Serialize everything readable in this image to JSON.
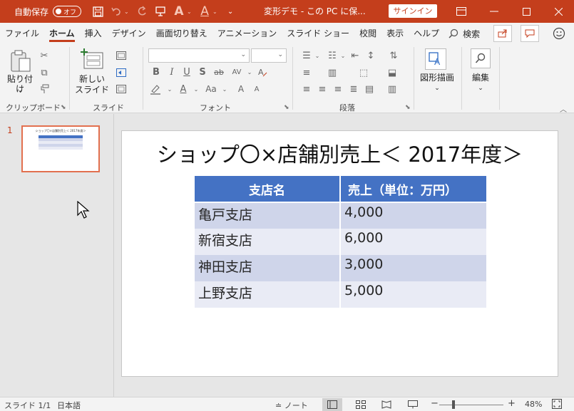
{
  "titlebar": {
    "autosave_label": "自動保存",
    "autosave_state": "オフ",
    "doc_title": "変形デモ - この PC に保...",
    "signin_label": "サインイン"
  },
  "tabs": [
    "ファイル",
    "ホーム",
    "挿入",
    "デザイン",
    "画面切り替え",
    "アニメーション",
    "スライド ショー",
    "校閲",
    "表示",
    "ヘルプ"
  ],
  "active_tab": "ホーム",
  "search_label": "検索",
  "ribbon": {
    "paste_label": "貼り付け",
    "new_slide_label_1": "新しい",
    "new_slide_label_2": "スライド",
    "shape_label": "図形描画",
    "edit_label": "編集",
    "groups": {
      "clipboard": "クリップボード",
      "slides": "スライド",
      "font": "フォント",
      "paragraph": "段落"
    },
    "font_buttons": {
      "bold": "B",
      "italic": "I",
      "underline": "U",
      "shadow": "S",
      "strike": "ab",
      "spacing": "AV",
      "case": "Aa",
      "grow": "A",
      "shrink": "A"
    }
  },
  "thumbnail": {
    "number": "1"
  },
  "slide": {
    "title": "ショップ〇×店舗別売上＜ 2017年度＞",
    "table": {
      "headers": [
        "支店名",
        "売上（単位：万円）"
      ],
      "rows": [
        [
          "亀戸支店",
          "4,000"
        ],
        [
          "新宿支店",
          "6,000"
        ],
        [
          "神田支店",
          "3,000"
        ],
        [
          "上野支店",
          "5,000"
        ]
      ]
    }
  },
  "status": {
    "slide_count": "スライド 1/1",
    "language": "日本語",
    "notes": "ノート",
    "zoom": "48%"
  },
  "colors": {
    "accent": "#c43e1c",
    "table_header": "#4472c4",
    "table_row_dark": "#cfd5ea",
    "table_row_light": "#e9ebf5"
  }
}
